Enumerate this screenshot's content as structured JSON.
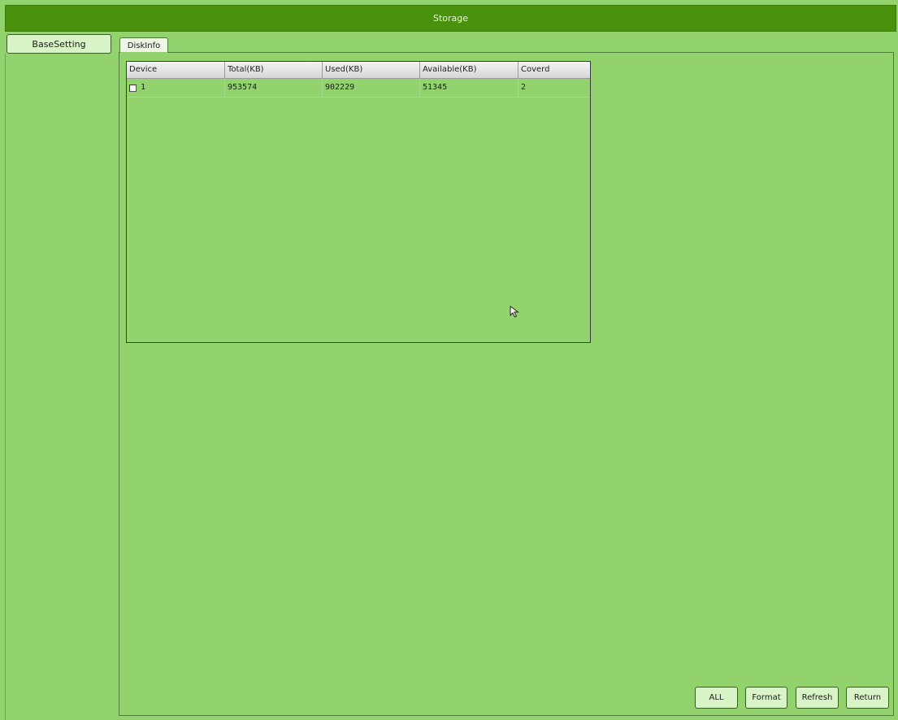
{
  "window": {
    "title": "Storage"
  },
  "sidebar": {
    "items": [
      {
        "label": "BaseSetting"
      }
    ]
  },
  "tabs": [
    {
      "label": "DiskInfo"
    }
  ],
  "table": {
    "columns": [
      "Device",
      "Total(KB)",
      "Used(KB)",
      "Available(KB)",
      "Coverd"
    ],
    "rows": [
      {
        "device": "1",
        "total": "953574",
        "used": "902229",
        "available": "51345",
        "coverd": "2",
        "checked": false
      }
    ]
  },
  "buttons": {
    "all": "ALL",
    "format": "Format",
    "refresh": "Refresh",
    "return": "Return"
  },
  "colors": {
    "background": "#92d36d",
    "titlebar": "#4a920d",
    "button_bg": "#d9f5c8"
  },
  "icons": {
    "cursor": "mouse-pointer-icon",
    "checkbox": "checkbox-icon"
  }
}
